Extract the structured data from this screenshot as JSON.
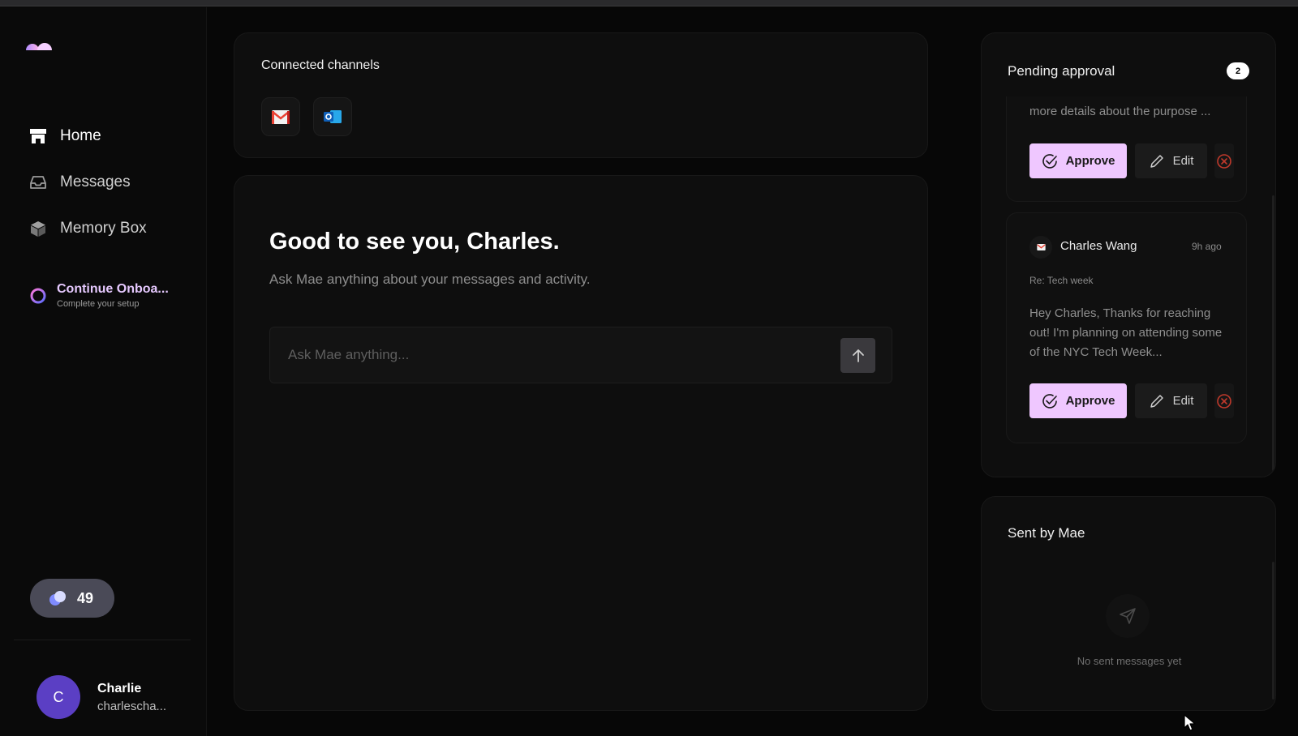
{
  "sidebar": {
    "nav": [
      {
        "label": "Home",
        "icon": "home-icon"
      },
      {
        "label": "Messages",
        "icon": "inbox-icon"
      },
      {
        "label": "Memory Box",
        "icon": "box-icon"
      }
    ],
    "onboarding": {
      "title": "Continue Onboa...",
      "subtitle": "Complete your setup"
    },
    "credits": "49",
    "user": {
      "initial": "C",
      "name": "Charlie",
      "email": "charlescha..."
    }
  },
  "channels": {
    "title": "Connected channels",
    "items": [
      {
        "name": "gmail-icon"
      },
      {
        "name": "outlook-icon"
      }
    ]
  },
  "chat": {
    "greeting": "Good to see you, Charles.",
    "subtitle": "Ask Mae anything about your messages and activity.",
    "placeholder": "Ask Mae anything..."
  },
  "pending": {
    "title": "Pending approval",
    "count": "2",
    "messages": [
      {
        "preview": "more details about the purpose ...",
        "approve": "Approve",
        "edit": "Edit"
      },
      {
        "sender": "Charles Wang",
        "time": "9h ago",
        "subject": "Re: Tech week",
        "preview": "Hey Charles, Thanks for reaching out! I'm planning on attending some of the NYC Tech Week...",
        "approve": "Approve",
        "edit": "Edit"
      }
    ]
  },
  "sent": {
    "title": "Sent by Mae",
    "empty": "No sent messages yet"
  },
  "colors": {
    "background": "#070707",
    "card": "#0e0e0e",
    "accent": "#efc7ff",
    "avatar": "#5b3fc4",
    "reject": "#c0392b"
  }
}
